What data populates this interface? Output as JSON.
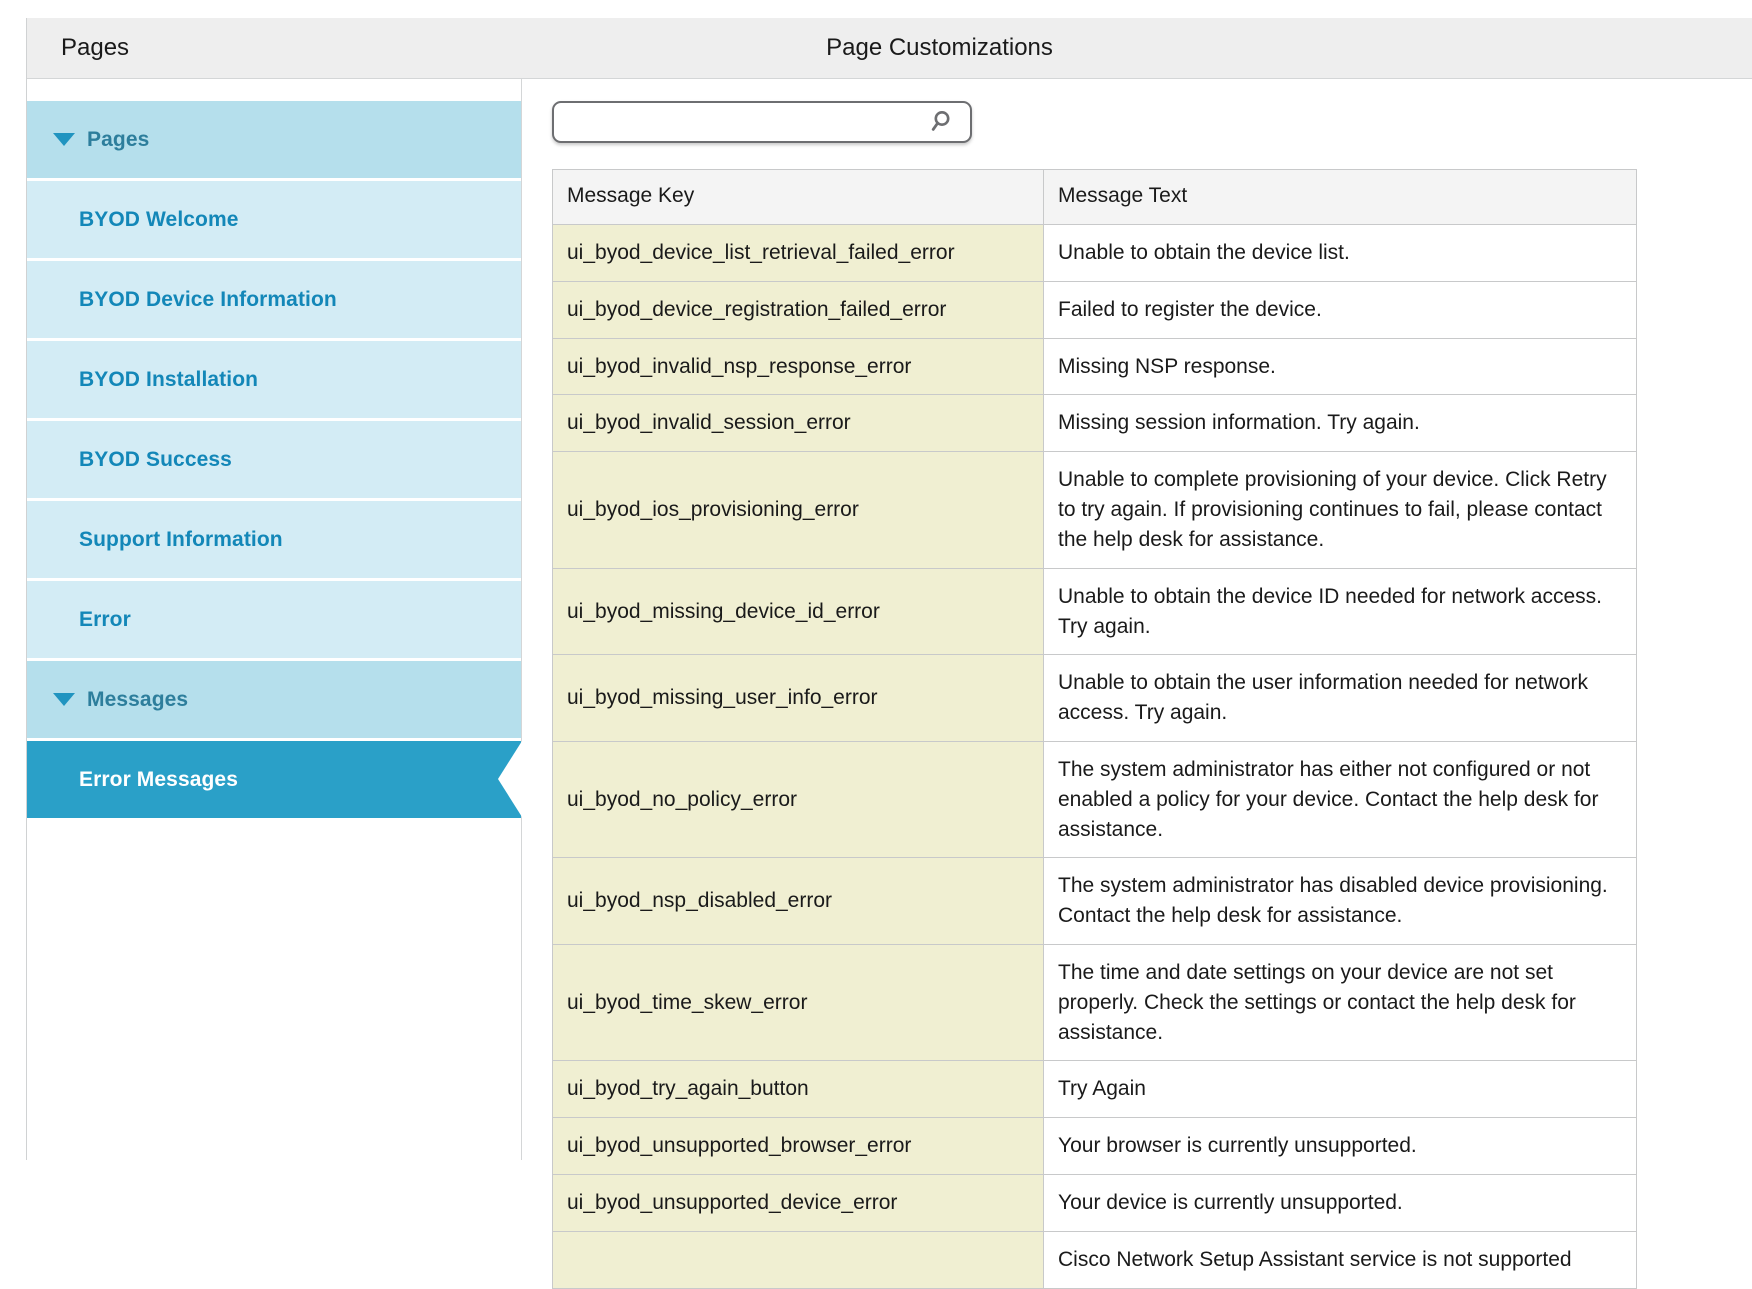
{
  "header": {
    "left_title": "Pages",
    "center_title": "Page Customizations"
  },
  "search": {
    "value": "",
    "placeholder": "",
    "icon": "search-icon"
  },
  "sidebar": {
    "items": [
      {
        "label": "Pages",
        "type": "group",
        "expanded": true,
        "caret": "triangle-down-icon"
      },
      {
        "label": "BYOD Welcome",
        "type": "child",
        "selected": false
      },
      {
        "label": "BYOD Device Information",
        "type": "child",
        "selected": false
      },
      {
        "label": "BYOD Installation",
        "type": "child",
        "selected": false
      },
      {
        "label": "BYOD Success",
        "type": "child",
        "selected": false
      },
      {
        "label": "Support Information",
        "type": "child",
        "selected": false
      },
      {
        "label": "Error",
        "type": "child",
        "selected": false
      },
      {
        "label": "Messages",
        "type": "group",
        "expanded": true,
        "caret": "triangle-down-icon"
      },
      {
        "label": "Error Messages",
        "type": "child",
        "selected": true
      }
    ]
  },
  "table": {
    "columns": [
      "Message Key",
      "Message Text"
    ],
    "rows": [
      {
        "key": "ui_byod_device_list_retrieval_failed_error",
        "text": "Unable to obtain the device list."
      },
      {
        "key": "ui_byod_device_registration_failed_error",
        "text": "Failed to register the device."
      },
      {
        "key": "ui_byod_invalid_nsp_response_error",
        "text": "Missing NSP response."
      },
      {
        "key": "ui_byod_invalid_session_error",
        "text": "Missing session information. Try again."
      },
      {
        "key": "ui_byod_ios_provisioning_error",
        "text": "Unable to complete provisioning of your device. Click Retry to try again. If provisioning continues to fail, please contact the help desk for assistance."
      },
      {
        "key": "ui_byod_missing_device_id_error",
        "text": "Unable to obtain the device ID needed for network access. Try again."
      },
      {
        "key": "ui_byod_missing_user_info_error",
        "text": "Unable to obtain the user information needed for network access. Try again."
      },
      {
        "key": "ui_byod_no_policy_error",
        "text": "The system administrator has either not configured or not enabled a policy for your device. Contact the help desk for assistance."
      },
      {
        "key": "ui_byod_nsp_disabled_error",
        "text": "The system administrator has disabled device provisioning. Contact the help desk for assistance."
      },
      {
        "key": "ui_byod_time_skew_error",
        "text": "The time and date settings on your device are not set properly. Check the settings or contact the help desk for assistance."
      },
      {
        "key": "ui_byod_try_again_button",
        "text": "Try Again"
      },
      {
        "key": "ui_byod_unsupported_browser_error",
        "text": "Your browser is currently unsupported."
      },
      {
        "key": "ui_byod_unsupported_device_error",
        "text": "Your device is currently unsupported."
      },
      {
        "key": "",
        "text": "Cisco Network Setup Assistant service is not supported"
      }
    ]
  },
  "colors": {
    "accent": "#2aa0c8",
    "group_row": "#b5dfec",
    "child_row": "#d3ecf5",
    "link_text": "#1387b8",
    "key_cell_bg": "#f0efd2",
    "header_bar": "#eeeeee"
  }
}
